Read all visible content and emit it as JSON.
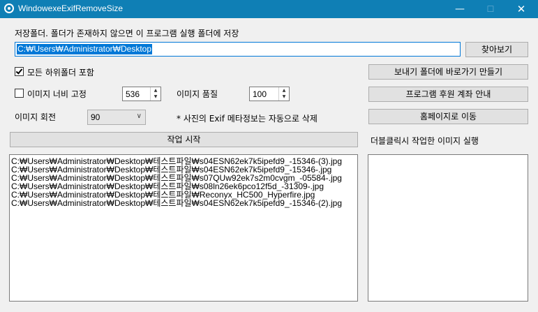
{
  "window": {
    "title": "WindowexeExifRemoveSize",
    "minimize_glyph": "—",
    "maximize_glyph": "☐",
    "close_glyph": "✕"
  },
  "save_folder": {
    "label": "저장폴더. 폴더가 존재하지 않으면 이 프로그램 실행 폴더에 저장",
    "path": "C:₩Users₩Administrator₩Desktop",
    "browse_label": "찾아보기"
  },
  "options": {
    "include_subfolders_label": "모든 하위폴더 포함",
    "include_subfolders_checked": true,
    "fixed_width_label": "이미지 너비 고정",
    "fixed_width_checked": false,
    "width_value": "536",
    "quality_label": "이미지 품질",
    "quality_value": "100",
    "rotate_label": "이미지 회전",
    "rotate_value": "90",
    "exif_note": "* 사진의 Exif 메타정보는 자동으로 삭제"
  },
  "side_buttons": {
    "shortcut": "보내기 폴더에 바로가기 만들기",
    "donate": "프로그램 후원 계좌 안내",
    "homepage": "홈페이지로 이동"
  },
  "start_button": "작업 시작",
  "double_click_label": "더블클릭시 작업한 이미지 실행",
  "file_list": [
    "C:₩Users₩Administrator₩Desktop₩테스트파일₩s04ESN62ek7k5ipefd9_-15346-(3).jpg",
    "C:₩Users₩Administrator₩Desktop₩테스트파일₩s04ESN62ek7k5ipefd9_-15346-.jpg",
    "C:₩Users₩Administrator₩Desktop₩테스트파일₩s07QUw92ek7s2m0cvgm_-05584-.jpg",
    "C:₩Users₩Administrator₩Desktop₩테스트파일₩s08ln26ek6pco12f5d_-31309-.jpg",
    "C:₩Users₩Administrator₩Desktop₩테스트파일₩Reconyx_HC500_Hyperfire.jpg",
    "C:₩Users₩Administrator₩Desktop₩테스트파일₩s04ESN62ek7k5ipefd9_-15346-(2).jpg"
  ]
}
